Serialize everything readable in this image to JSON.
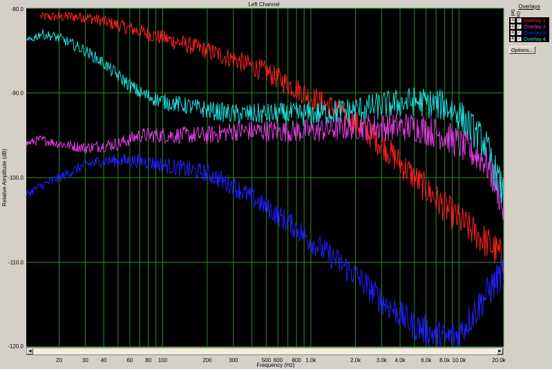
{
  "window": {
    "title": "Left Channel"
  },
  "overlays_panel": {
    "title": "Overlays",
    "col_select": "Sel",
    "col_on": "On",
    "items": [
      {
        "index": "1",
        "label": "Overlay 1",
        "checked": true,
        "color": "#ff2020"
      },
      {
        "index": "2",
        "label": "Overlay 2",
        "checked": true,
        "color": "#e040e0"
      },
      {
        "index": "3",
        "label": "Overlay 3",
        "checked": true,
        "color": "#2020ff"
      },
      {
        "index": "4",
        "label": "Overlay 4",
        "checked": true,
        "color": "#20e0e0"
      }
    ],
    "options_label": "Options..."
  },
  "scrollbar": {
    "left_arrow": "◄",
    "right_arrow": "►"
  },
  "chart_data": {
    "type": "line",
    "title": "Left Channel",
    "xlabel": "Frequency (Hz)",
    "ylabel": "Relative Amplitude (dB)",
    "xscale": "log",
    "xlim": [
      12,
      20000
    ],
    "ylim": [
      -120,
      -80
    ],
    "grid": true,
    "x_ticks": [
      20,
      30,
      40,
      50,
      60,
      70,
      80,
      90,
      100,
      200,
      300,
      400,
      500,
      600,
      700,
      800,
      900,
      1000,
      2000,
      3000,
      4000,
      5000,
      6000,
      7000,
      8000,
      9000,
      10000,
      20000
    ],
    "x_tick_labels": [
      {
        "value": 20,
        "label": "20"
      },
      {
        "value": 30,
        "label": "30"
      },
      {
        "value": 40,
        "label": "40"
      },
      {
        "value": 60,
        "label": "60"
      },
      {
        "value": 80,
        "label": "80"
      },
      {
        "value": 100,
        "label": "100"
      },
      {
        "value": 200,
        "label": "200"
      },
      {
        "value": 300,
        "label": "300"
      },
      {
        "value": 500,
        "label": "500"
      },
      {
        "value": 600,
        "label": "600"
      },
      {
        "value": 800,
        "label": "800"
      },
      {
        "value": 1000,
        "label": "1.0k"
      },
      {
        "value": 2000,
        "label": "2.0k"
      },
      {
        "value": 3000,
        "label": "3.0k"
      },
      {
        "value": 4000,
        "label": "4.0k"
      },
      {
        "value": 6000,
        "label": "6.0k"
      },
      {
        "value": 8000,
        "label": "8.0k"
      },
      {
        "value": 10000,
        "label": "10.0k"
      },
      {
        "value": 20000,
        "label": "20.0k"
      }
    ],
    "y_ticks": [
      {
        "value": -80,
        "label": "-80.0"
      },
      {
        "value": -90,
        "label": "-90.0"
      },
      {
        "value": -100,
        "label": "-100.0"
      },
      {
        "value": -110,
        "label": "-110.0"
      },
      {
        "value": -120,
        "label": "-120.0"
      }
    ],
    "series": [
      {
        "name": "Overlay 1",
        "color": "#ff2020",
        "x": [
          15,
          20,
          30,
          50,
          100,
          200,
          300,
          500,
          800,
          1000,
          1500,
          2000,
          3000,
          5000,
          8000,
          10000,
          15000,
          20000
        ],
        "y": [
          -81,
          -81,
          -81,
          -82,
          -83.5,
          -85,
          -86,
          -87.5,
          -89.5,
          -90.5,
          -92,
          -93.5,
          -96,
          -100,
          -103.5,
          -105,
          -107.5,
          -109.5
        ]
      },
      {
        "name": "Overlay 2",
        "color": "#e040e0",
        "x": [
          12,
          15,
          20,
          30,
          50,
          70,
          100,
          200,
          300,
          500,
          800,
          1000,
          2000,
          3000,
          5000,
          8000,
          10000,
          15000,
          18000,
          20000
        ],
        "y": [
          -96,
          -95.5,
          -96,
          -96.5,
          -96,
          -95,
          -95,
          -95,
          -94.5,
          -94.5,
          -94.5,
          -94.5,
          -94,
          -94,
          -94,
          -95,
          -96,
          -98,
          -101,
          -104
        ]
      },
      {
        "name": "Overlay 3",
        "color": "#2020ff",
        "x": [
          12,
          15,
          20,
          30,
          40,
          50,
          70,
          100,
          200,
          300,
          500,
          800,
          1000,
          2000,
          3000,
          5000,
          8000,
          10000,
          15000,
          20000
        ],
        "y": [
          -102,
          -101,
          -100,
          -98.5,
          -98,
          -98,
          -98,
          -98.5,
          -99.5,
          -101,
          -103.5,
          -106,
          -107.5,
          -111.5,
          -114.5,
          -117.5,
          -119,
          -118.5,
          -114,
          -111
        ]
      },
      {
        "name": "Overlay 4",
        "color": "#20e0e0",
        "x": [
          12,
          15,
          20,
          30,
          40,
          50,
          70,
          100,
          200,
          300,
          500,
          800,
          1000,
          2000,
          3000,
          5000,
          8000,
          10000,
          15000,
          20000
        ],
        "y": [
          -84,
          -83,
          -83.5,
          -85,
          -86.5,
          -88,
          -90,
          -91,
          -92,
          -92.5,
          -92.5,
          -92.5,
          -92.5,
          -92,
          -91.5,
          -91,
          -91.5,
          -92.5,
          -96,
          -102
        ]
      }
    ]
  }
}
